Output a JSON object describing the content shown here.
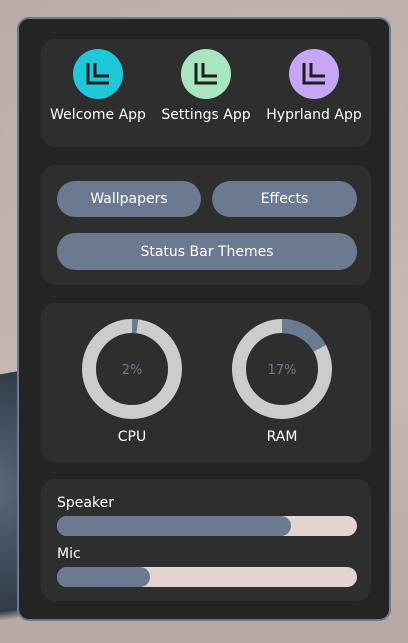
{
  "apps": [
    {
      "label": "Welcome App",
      "icon": "welcome-app-icon",
      "color": "#1ec8d8"
    },
    {
      "label": "Settings App",
      "icon": "settings-app-icon",
      "color": "#a8e6bf"
    },
    {
      "label": "Hyprland App",
      "icon": "hyprland-app-icon",
      "color": "#c7a6f5"
    }
  ],
  "buttons": {
    "wallpapers": "Wallpapers",
    "effects": "Effects",
    "status_bar_themes": "Status Bar Themes"
  },
  "gauges": {
    "cpu": {
      "label": "CPU",
      "value_text": "2%",
      "percent": 2
    },
    "ram": {
      "label": "RAM",
      "value_text": "17%",
      "percent": 17
    }
  },
  "sliders": {
    "speaker": {
      "label": "Speaker",
      "level": 0.78
    },
    "mic": {
      "label": "Mic",
      "level": 0.31
    }
  },
  "colors": {
    "accent": "#6b7a90",
    "track": "#cccccc",
    "slider_track": "#e2d4cf",
    "panel": "#242424",
    "card": "#2e2e2e"
  }
}
